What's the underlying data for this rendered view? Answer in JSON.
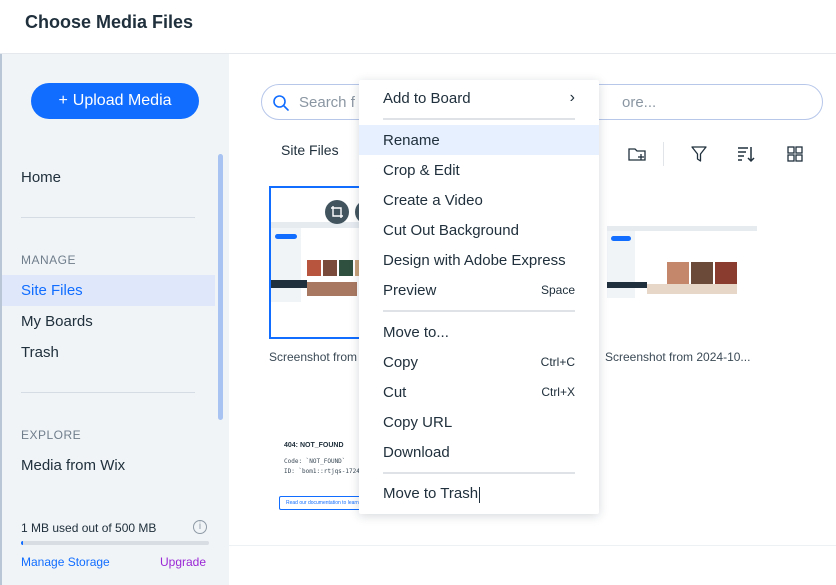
{
  "header": {
    "title": "Choose Media Files"
  },
  "sidebar": {
    "upload_label": "Upload Media",
    "upload_plus": "+",
    "home": "Home",
    "manage_label": "MANAGE",
    "manage_items": [
      "Site Files",
      "My Boards",
      "Trash"
    ],
    "explore_label": "EXPLORE",
    "explore_items": [
      "Media from Wix"
    ],
    "storage": {
      "text": "1 MB used out of 500 MB",
      "used_fraction": 0.002,
      "info": "i"
    },
    "manage_storage": "Manage Storage",
    "upgrade": "Upgrade"
  },
  "main": {
    "search_placeholder_start": "Search f",
    "search_placeholder_end": "ore...",
    "tab_label": "Site Files",
    "toolbar_icons": [
      "add-folder-icon",
      "filter-icon",
      "sort-icon",
      "grid-view-icon"
    ],
    "cards": [
      {
        "label": "Screenshot from "
      },
      {
        "label": "Screenshot from 2024-10..."
      }
    ],
    "error_card": {
      "title": "404: NOT_FOUND",
      "code_line": "Code: `NOT_FOUND`",
      "id_line": "ID: `bom1::rtjqs-17244769066",
      "button": "Read our documentation to learn more"
    }
  },
  "context_menu": {
    "items": [
      {
        "label": "Add to Board",
        "shortcut": "›"
      },
      {
        "label": "Rename",
        "shortcut": ""
      },
      {
        "label": "Crop & Edit",
        "shortcut": ""
      },
      {
        "label": "Create a Video",
        "shortcut": ""
      },
      {
        "label": "Cut Out Background",
        "shortcut": ""
      },
      {
        "label": "Design with Adobe Express",
        "shortcut": ""
      },
      {
        "label": "Preview",
        "shortcut": "Space"
      },
      {
        "label": "Move to...",
        "shortcut": ""
      },
      {
        "label": "Copy",
        "shortcut": "Ctrl+C"
      },
      {
        "label": "Cut",
        "shortcut": "Ctrl+X"
      },
      {
        "label": "Copy URL",
        "shortcut": ""
      },
      {
        "label": "Download",
        "shortcut": ""
      },
      {
        "label": "Move to Trash",
        "shortcut": ""
      }
    ]
  },
  "colors": {
    "accent": "#116dff",
    "upgrade": "#9a27d5",
    "sidebar_bg": "#f0f4f7",
    "active_bg": "#dfe8fb"
  }
}
